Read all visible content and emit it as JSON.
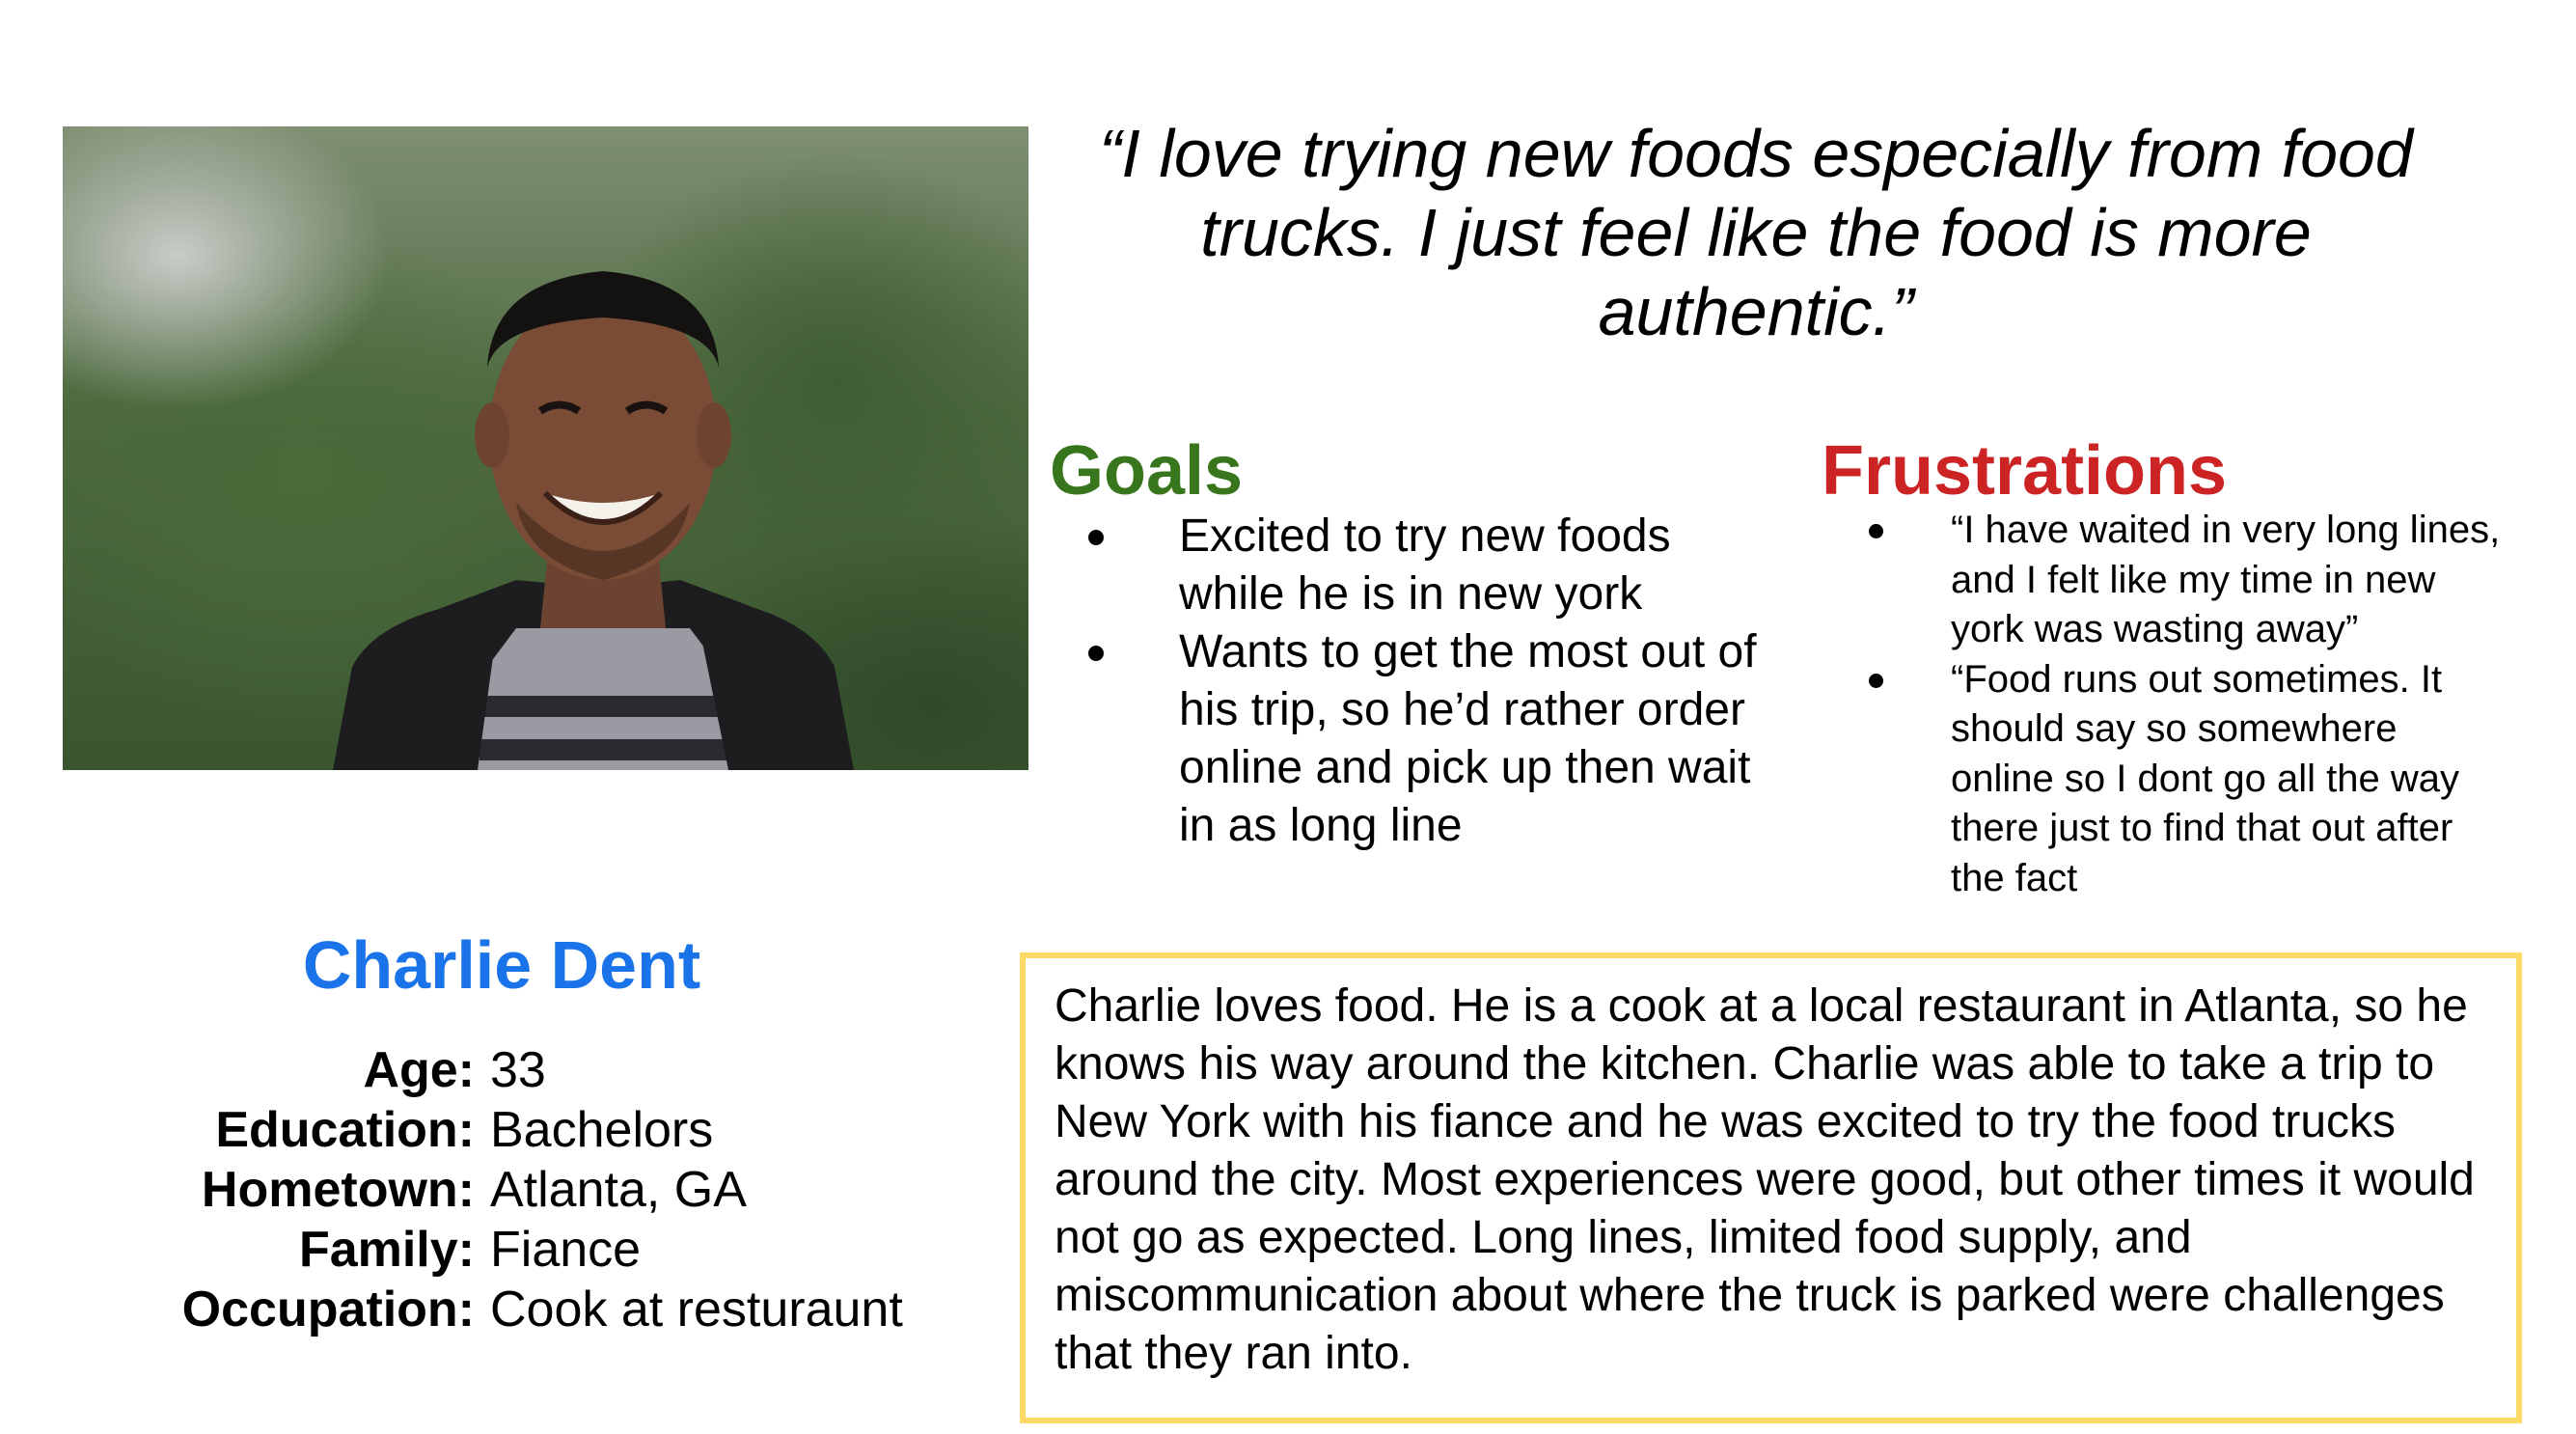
{
  "quote": "“I love trying new foods especially from food trucks. I just feel like the food is more authentic.”",
  "goals": {
    "title": "Goals",
    "items": [
      "Excited to try new foods while he is in new york",
      "Wants to get the most out of his trip, so he’d rather order online and pick up then wait in as long line"
    ]
  },
  "frustrations": {
    "title": "Frustrations",
    "items": [
      "“I have waited in very long lines, and I felt like my time in new york was wasting away”",
      "“Food runs out sometimes. It should say so somewhere online so I dont go all the way there just to find that out after the fact"
    ]
  },
  "persona": {
    "name": "Charlie Dent",
    "attributes": [
      {
        "label": "Age:",
        "value": "33"
      },
      {
        "label": "Education:",
        "value": "Bachelors"
      },
      {
        "label": "Hometown:",
        "value": "Atlanta, GA"
      },
      {
        "label": "Family:",
        "value": "Fiance"
      },
      {
        "label": "Occupation:",
        "value": "Cook at resturaunt"
      }
    ]
  },
  "bio": "Charlie loves food. He is a cook at a local restaurant in Atlanta, so he knows his way around the kitchen. Charlie was able to take a trip to New York with his fiance and he was excited to try the food trucks around the city. Most experiences were good, but other times it would not go as expected. Long lines, limited food supply, and miscommunication about where the truck is parked were challenges that they ran into.",
  "colors": {
    "goals": "#38761d",
    "frustrations": "#cc2424",
    "name": "#1a73e8",
    "bio_border": "#ffd966"
  }
}
